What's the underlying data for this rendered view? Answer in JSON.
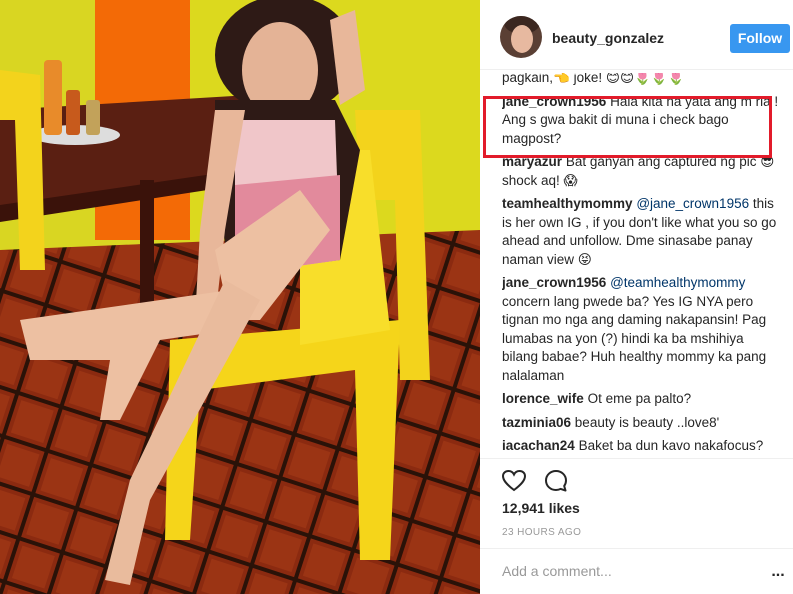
{
  "post": {
    "username": "beauty_gonzalez",
    "follow_label": "Follow",
    "photo_alt": "Woman sitting on a yellow plastic chair"
  },
  "comments": [
    {
      "text": "pagkain,👈 joke! 😊😊🌷🌷🌷"
    },
    {
      "user": "jane_crown1956",
      "text": "Hala kita na yata ang m ria ! Ang s gwa bakit di muna i check bago magpost?",
      "highlighted": true
    },
    {
      "user": "maryazur",
      "text": "Bat ganyan ang captured ng pic 😎 shock aq! 😱"
    },
    {
      "user": "teamhealthymommy",
      "mention": "@jane_crown1956",
      "text": "this is her own IG , if you don't like what you so go ahead and unfollow. Dme sinasabe panay naman view 😝"
    },
    {
      "user": "jane_crown1956",
      "mention": "@teamhealthymommy",
      "text": "concern lang pwede ba? Yes IG NYA pero tignan mo nga ang daming nakapansin! Pag lumabas na yon (?) hindi ka ba mshihiya bilang babae? Huh healthy mommy ka pang nalalaman"
    },
    {
      "user": "lorence_wife",
      "text": "Ot eme pa palto?"
    },
    {
      "user": "tazminia06",
      "text": "beauty is beauty ..love8'"
    },
    {
      "user": "iacachan24",
      "text": "Baket ba dun kavo nakafocus?"
    }
  ],
  "actions": {
    "like_icon": "heart-icon",
    "comment_icon": "speech-bubble-icon",
    "likes": "12,941 likes",
    "time": "23 HOURS AGO"
  },
  "add_comment": {
    "placeholder": "Add a comment...",
    "more_label": "..."
  },
  "colors": {
    "follow": "#3897f0",
    "highlight": "#e21b2a",
    "mention": "#003569",
    "muted": "#999999"
  }
}
